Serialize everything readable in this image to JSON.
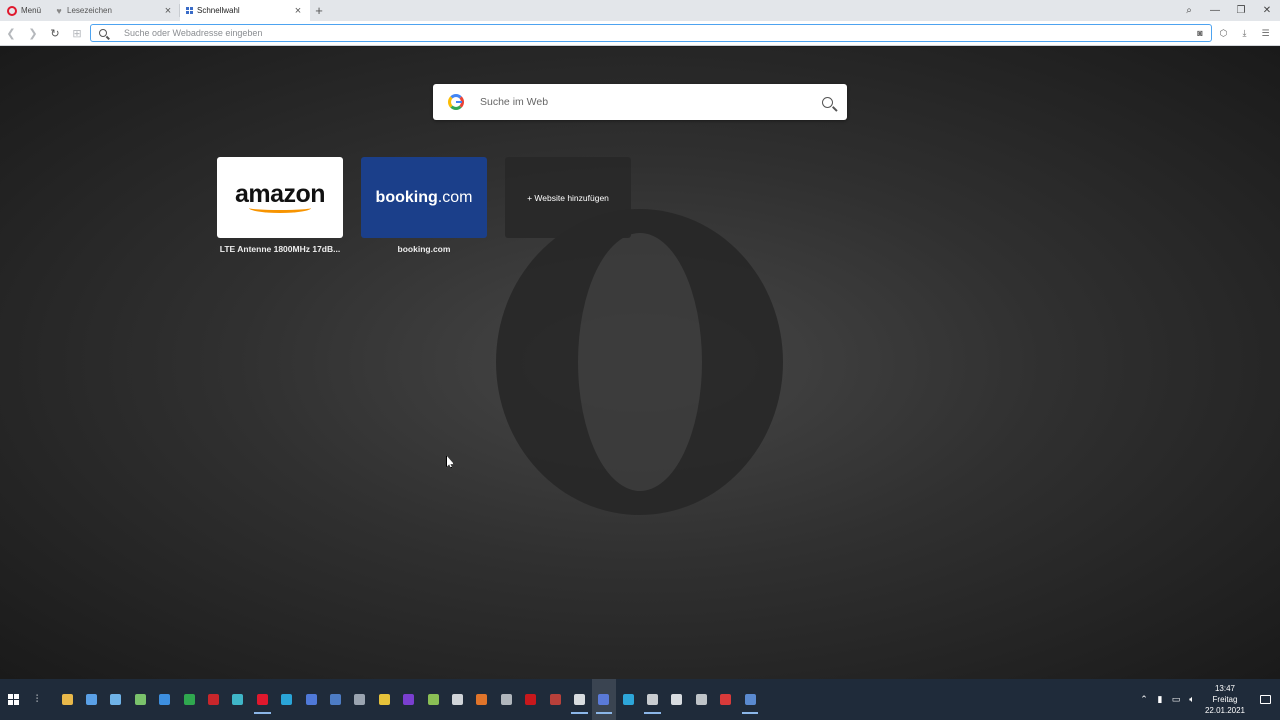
{
  "browser": {
    "menu_label": "Menü",
    "tabs": [
      {
        "label": "Lesezeichen",
        "icon": "heart-icon",
        "active": false
      },
      {
        "label": "Schnellwahl",
        "icon": "speed-dial-icon",
        "active": true
      }
    ],
    "address_placeholder": "Suche oder Webadresse eingeben",
    "accent_color": "#4da3f0",
    "opera_red": "#e0182d"
  },
  "speed_dial": {
    "search_placeholder": "Suche im Web",
    "tiles": [
      {
        "logo_text": "amazon",
        "caption": "LTE Antenne 1800MHz 17dB..."
      },
      {
        "logo_text_bold": "booking",
        "logo_text_light": ".com",
        "caption": "booking.com"
      },
      {
        "label": "+ Website hinzufügen"
      }
    ]
  },
  "taskbar": {
    "apps": [
      {
        "name": "file-explorer-icon",
        "color": "#e8b84a"
      },
      {
        "name": "network-icon",
        "color": "#5aa0e6"
      },
      {
        "name": "notepad-icon",
        "color": "#6fb3e8"
      },
      {
        "name": "tool-icon",
        "color": "#7ac26b"
      },
      {
        "name": "cloud-icon",
        "color": "#3d8fe0"
      },
      {
        "name": "spreadsheet-icon",
        "color": "#2fa84f"
      },
      {
        "name": "filezilla-icon",
        "color": "#c8262b"
      },
      {
        "name": "remote-icon",
        "color": "#3fb6c8"
      },
      {
        "name": "opera-icon",
        "color": "#e0182d"
      },
      {
        "name": "edge-icon",
        "color": "#2aa5d8"
      },
      {
        "name": "browser-icon",
        "color": "#4f79d8"
      },
      {
        "name": "steam-icon",
        "color": "#4d7cc4"
      },
      {
        "name": "circle-app-icon",
        "color": "#9aa4b0"
      },
      {
        "name": "yellow-app-icon",
        "color": "#e6c23a"
      },
      {
        "name": "purple-app-icon",
        "color": "#7a3fd0"
      },
      {
        "name": "green-app-icon",
        "color": "#8abf55"
      },
      {
        "name": "gear-app-icon",
        "color": "#d0d4d8"
      },
      {
        "name": "orange-app-icon",
        "color": "#e0742a"
      },
      {
        "name": "dark-app-icon",
        "color": "#b0b6bc"
      },
      {
        "name": "red-app-icon",
        "color": "#c8181c"
      },
      {
        "name": "rar-app-icon",
        "color": "#b8403a"
      },
      {
        "name": "tool2-app-icon",
        "color": "#d8dcdf"
      },
      {
        "name": "media-app-icon",
        "color": "#5a7ad8"
      },
      {
        "name": "blue-app-icon",
        "color": "#2da6d9"
      },
      {
        "name": "clock-app-icon",
        "color": "#c8ccd0"
      },
      {
        "name": "phone-app-icon",
        "color": "#d8dce0"
      },
      {
        "name": "terminal-app-icon",
        "color": "#bfc4c8"
      },
      {
        "name": "screen-app-icon",
        "color": "#d83a3a"
      },
      {
        "name": "steam2-app-icon",
        "color": "#5a8ad0"
      }
    ],
    "time": "13:47",
    "day": "Freitag",
    "date": "22.01.2021"
  }
}
